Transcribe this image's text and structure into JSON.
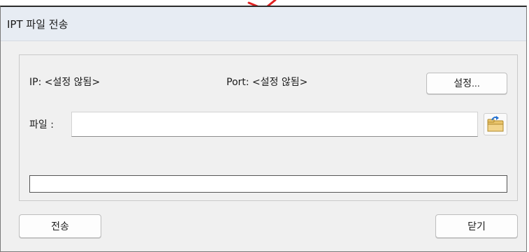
{
  "window": {
    "title": "IPT 파일 전송"
  },
  "connection": {
    "ip_text": "IP: <설정 않됨>",
    "port_text": "Port: <설정 않됨>",
    "settings_label": "설정..."
  },
  "file": {
    "label": "파일 :",
    "value": "",
    "browse_icon": "folder-open-icon"
  },
  "progress": {
    "value": 0
  },
  "footer": {
    "send_label": "전송",
    "close_label": "닫기"
  },
  "colors": {
    "titlebar": "#e7ecf3",
    "window_bg": "#f0f0f0",
    "annotation_red": "#e02020"
  }
}
